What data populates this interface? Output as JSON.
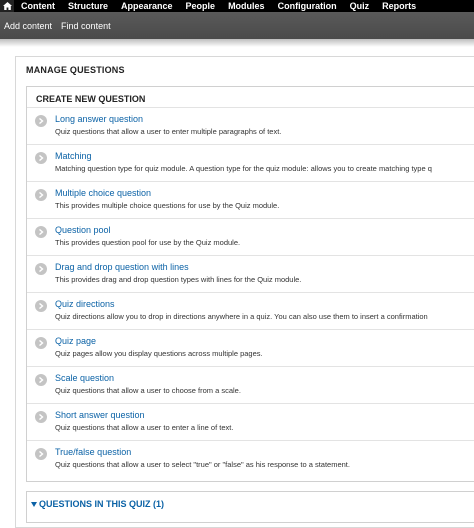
{
  "toolbar": {
    "items": [
      "Content",
      "Structure",
      "Appearance",
      "People",
      "Modules",
      "Configuration",
      "Quiz",
      "Reports"
    ]
  },
  "shortcuts": {
    "items": [
      "Add content",
      "Find content"
    ]
  },
  "manage": {
    "title": "MANAGE QUESTIONS"
  },
  "create": {
    "title": "CREATE NEW QUESTION",
    "items": [
      {
        "label": "Long answer question",
        "desc": "Quiz questions that allow a user to enter multiple paragraphs of text."
      },
      {
        "label": "Matching",
        "desc": "Matching question type for quiz module. A question type for the quiz module: allows you to create matching type q"
      },
      {
        "label": "Multiple choice question",
        "desc": "This provides multiple choice questions for use by the Quiz module."
      },
      {
        "label": "Question pool",
        "desc": "This provides question pool for use by the Quiz module."
      },
      {
        "label": "Drag and drop question with lines",
        "desc": "This provides drag and drop question types with lines for the Quiz module."
      },
      {
        "label": "Quiz directions",
        "desc": "Quiz directions allow you to drop in directions anywhere in a quiz. You can also use them to insert a confirmation"
      },
      {
        "label": "Quiz page",
        "desc": "Quiz pages allow you display questions across multiple pages."
      },
      {
        "label": "Scale question",
        "desc": "Quiz questions that allow a user to choose from a scale."
      },
      {
        "label": "Short answer question",
        "desc": "Quiz questions that allow a user to enter a line of text."
      },
      {
        "label": "True/false question",
        "desc": "Quiz questions that allow a user to select \"true\" or \"false\" as his response to a statement."
      }
    ]
  },
  "questions_in_quiz": {
    "label": "QUESTIONS IN THIS QUIZ (1)"
  },
  "icons": {
    "home": "home-icon",
    "row_arrow": "chevron-right-icon",
    "toggle": "triangle-down-icon"
  }
}
